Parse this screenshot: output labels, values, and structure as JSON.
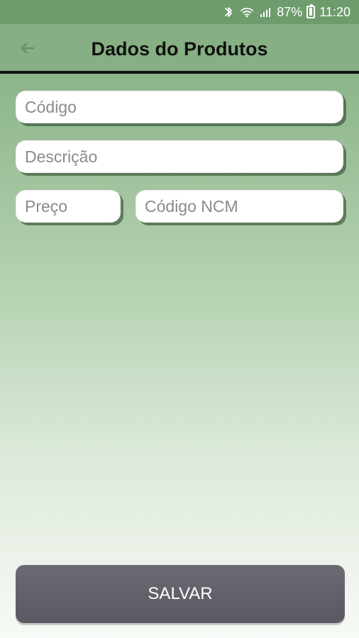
{
  "status_bar": {
    "battery": "87%",
    "time": "11:20",
    "icons": [
      "bluetooth-icon",
      "wifi-icon",
      "signal-icon",
      "battery-icon"
    ]
  },
  "header": {
    "title": "Dados do Produtos",
    "back_icon": "arrow-left-icon"
  },
  "form": {
    "codigo": {
      "value": "",
      "placeholder": "Código"
    },
    "descricao": {
      "value": "",
      "placeholder": "Descrição"
    },
    "preco": {
      "value": "",
      "placeholder": "Preço"
    },
    "ncm": {
      "value": "",
      "placeholder": "Código NCM"
    }
  },
  "actions": {
    "save_label": "SALVAR"
  },
  "colors": {
    "accent_green": "#86b083",
    "save_button": "#5f5e67"
  }
}
